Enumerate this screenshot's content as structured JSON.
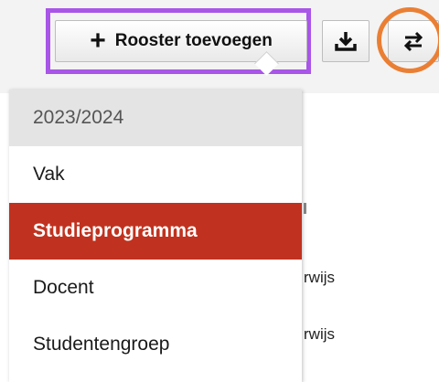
{
  "toolbar": {
    "add_label": "Rooster toevoegen",
    "add_icon": "plus-icon",
    "download_icon": "download-icon",
    "switch_icon": "swap-arrows-icon"
  },
  "menu": {
    "header": "2023/2024",
    "items": [
      {
        "label": "Vak",
        "active": false
      },
      {
        "label": "Studieprogramma",
        "active": true
      },
      {
        "label": "Docent",
        "active": false
      },
      {
        "label": "Studentengroep",
        "active": false
      }
    ]
  },
  "background": {
    "row_1_text": "rwijs",
    "row_2_text": "rwijs"
  },
  "colors": {
    "highlight_rect": "#a855e8",
    "highlight_circle": "#ea7f34",
    "active_item": "#c0321f"
  }
}
